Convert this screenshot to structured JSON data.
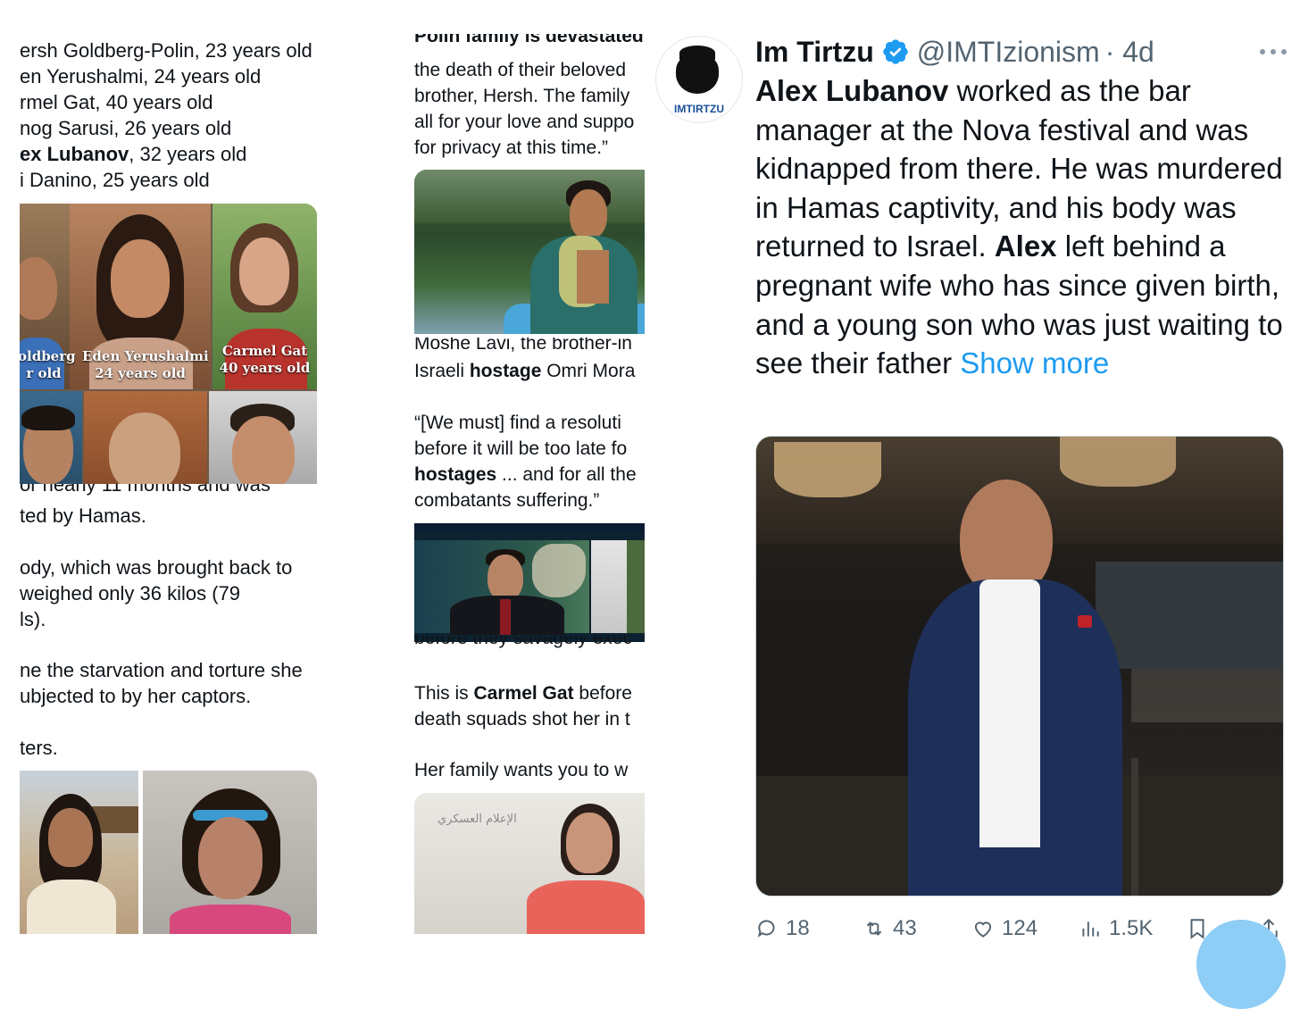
{
  "col1": {
    "list": [
      {
        "prefix": "ersh Goldberg-Polin",
        "bold": "",
        "suffix": ", 23 years old"
      },
      {
        "prefix": "en Yerushalmi",
        "bold": "",
        "suffix": ", 24 years old"
      },
      {
        "prefix": "rmel Gat",
        "bold": "",
        "suffix": ", 40 years old"
      },
      {
        "prefix": "nog Sarusi",
        "bold": "",
        "suffix": ", 26 years old"
      },
      {
        "prefix": "",
        "bold": "ex Lubanov",
        "suffix": ", 32 years old"
      },
      {
        "prefix": "i Danino",
        "bold": "",
        "suffix": ", 25 years old"
      }
    ],
    "captions": [
      {
        "line1": "oldberg",
        "line2": "r old"
      },
      {
        "line1": "Eden Yerushalmi",
        "line2": "24 years old"
      },
      {
        "line1": "Carmel Gat",
        "line2": "40 years old"
      }
    ],
    "cut_line": "or nearly 11 months and was",
    "para1": "ted by Hamas.",
    "para2a": "ody, which was brought back to",
    "para2b": " weighed only 36 kilos (79",
    "para2c": "ls).",
    "para3a": "ne the starvation and torture she",
    "para3b": "ubjected to by her captors.",
    "para4": "ters."
  },
  "col2": {
    "intro": [
      {
        "text": "Polin family is devastated",
        "bold": true
      },
      {
        "text": "the death of their beloved",
        "bold": false
      },
      {
        "text": "brother, Hersh. The family",
        "bold": false
      },
      {
        "text": "all for your love and suppo",
        "bold": false
      },
      {
        "text": "for privacy at this time.”",
        "bold": false
      }
    ],
    "caption_cut": "Moshe Lavi, the brother-in",
    "hostage_pre": "Israeli ",
    "hostage_bold": "hostage",
    "hostage_post": " Omri Mora",
    "quote1": "“[We must] find a resoluti",
    "quote2": "before it will be too late fo",
    "quote3_bold": "hostages",
    "quote3_post": " ... and for all the",
    "quote4": "combatants suffering.”",
    "before_cut": "before they savagely exec",
    "carmel_pre": "This is ",
    "carmel_bold": "Carmel Gat",
    "carmel_post": " before",
    "carmel2": "death squads shot her in t",
    "family": "Her family wants you to w",
    "hamas_logo_text": "الإعلام العسكري"
  },
  "tweet": {
    "avatar_text": "IMTIRTZU",
    "author": "Im Tirtzu",
    "handle": "@IMTIzionism",
    "time": "· 4d",
    "more_icon": "more-horizontal-icon",
    "body_bold1": "Alex Lubanov",
    "body1": " worked as the bar manager at the Nova festival and was kidnapped from there. He was murdered in Hamas captivity, and his body was returned to Israel. ",
    "body_bold2": "Alex",
    "body2": " left behind a pregnant wife who has since given birth, and a young son who was just waiting to see their father ",
    "show_more": "Show more",
    "stats": {
      "replies": "18",
      "reposts": "43",
      "likes": "124",
      "views": "1.5K"
    },
    "accent": "#1d9bf0",
    "verified_color": "#1d9bf0"
  }
}
